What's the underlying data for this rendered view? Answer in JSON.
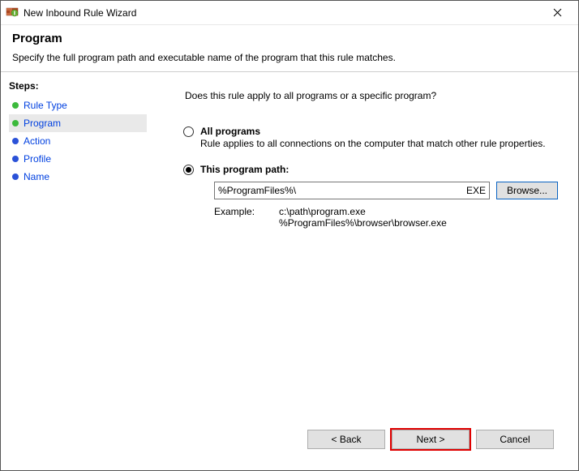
{
  "window": {
    "title": "New Inbound Rule Wizard"
  },
  "header": {
    "title": "Program",
    "description": "Specify the full program path and executable name of the program that this rule matches."
  },
  "sidebar": {
    "heading": "Steps:",
    "items": [
      {
        "label": "Rule Type",
        "color": "#3cba3c",
        "active": false
      },
      {
        "label": "Program",
        "color": "#3cba3c",
        "active": true
      },
      {
        "label": "Action",
        "color": "#2b52d8",
        "active": false
      },
      {
        "label": "Profile",
        "color": "#2b52d8",
        "active": false
      },
      {
        "label": "Name",
        "color": "#2b52d8",
        "active": false
      }
    ]
  },
  "main": {
    "question": "Does this rule apply to all programs or a specific program?",
    "option_all": {
      "label": "All programs",
      "desc": "Rule applies to all connections on the computer that match other rule properties."
    },
    "option_path": {
      "label": "This program path:",
      "value": "%ProgramFiles%\\",
      "suffix": "EXE",
      "browse": "Browse..."
    },
    "example": {
      "label": "Example:",
      "line1": "c:\\path\\program.exe",
      "line2": "%ProgramFiles%\\browser\\browser.exe"
    }
  },
  "footer": {
    "back": "< Back",
    "next": "Next >",
    "cancel": "Cancel"
  }
}
